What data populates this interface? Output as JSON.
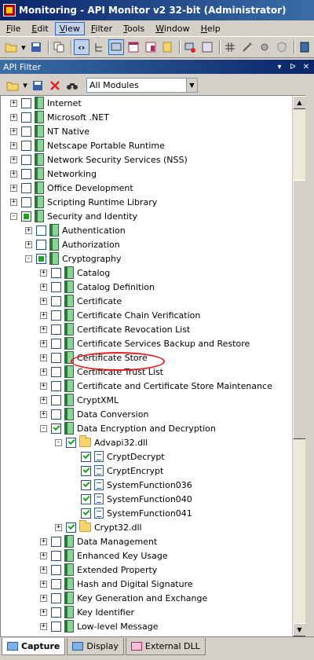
{
  "window": {
    "title": "Monitoring - API Monitor v2 32-bit (Administrator)"
  },
  "menu": [
    {
      "ul": "F",
      "rest": "ile"
    },
    {
      "ul": "E",
      "rest": "dit"
    },
    {
      "ul": "V",
      "rest": "iew",
      "active": true
    },
    {
      "ul": "F",
      "rest": "ilter"
    },
    {
      "ul": "T",
      "rest": "ools"
    },
    {
      "ul": "W",
      "rest": "indow"
    },
    {
      "ul": "H",
      "rest": "elp"
    }
  ],
  "panel": {
    "title": "API Filter",
    "buttons": [
      "▾",
      "ᐅ",
      "✕"
    ]
  },
  "filter": {
    "module_select": "All Modules"
  },
  "tree": [
    {
      "label": "Internet",
      "level": 0,
      "exp": "+",
      "chk": "",
      "icon": "book"
    },
    {
      "label": "Microsoft .NET",
      "level": 0,
      "exp": "+",
      "chk": "",
      "icon": "book"
    },
    {
      "label": "NT Native",
      "level": 0,
      "exp": "+",
      "chk": "",
      "icon": "book"
    },
    {
      "label": "Netscape Portable Runtime",
      "level": 0,
      "exp": "+",
      "chk": "",
      "icon": "book"
    },
    {
      "label": "Network Security Services (NSS)",
      "level": 0,
      "exp": "+",
      "chk": "",
      "icon": "book"
    },
    {
      "label": "Networking",
      "level": 0,
      "exp": "+",
      "chk": "",
      "icon": "book"
    },
    {
      "label": "Office Development",
      "level": 0,
      "exp": "+",
      "chk": "",
      "icon": "book"
    },
    {
      "label": "Scripting Runtime Library",
      "level": 0,
      "exp": "+",
      "chk": "",
      "icon": "book"
    },
    {
      "label": "Security and Identity",
      "level": 0,
      "exp": "−",
      "chk": "partial",
      "icon": "book"
    },
    {
      "label": "Authentication",
      "level": 1,
      "exp": "+",
      "chk": "",
      "icon": "book"
    },
    {
      "label": "Authorization",
      "level": 1,
      "exp": "+",
      "chk": "",
      "icon": "book"
    },
    {
      "label": "Cryptography",
      "level": 1,
      "exp": "−",
      "chk": "partial",
      "icon": "book"
    },
    {
      "label": "Catalog",
      "level": 2,
      "exp": "+",
      "chk": "",
      "icon": "book"
    },
    {
      "label": "Catalog Definition",
      "level": 2,
      "exp": "+",
      "chk": "",
      "icon": "book"
    },
    {
      "label": "Certificate",
      "level": 2,
      "exp": "+",
      "chk": "",
      "icon": "book"
    },
    {
      "label": "Certificate Chain Verification",
      "level": 2,
      "exp": "+",
      "chk": "",
      "icon": "book"
    },
    {
      "label": "Certificate Revocation List",
      "level": 2,
      "exp": "+",
      "chk": "",
      "icon": "book"
    },
    {
      "label": "Certificate Services Backup and Restore",
      "level": 2,
      "exp": "+",
      "chk": "",
      "icon": "book"
    },
    {
      "label": "Certificate Store",
      "level": 2,
      "exp": "+",
      "chk": "",
      "icon": "book"
    },
    {
      "label": "Certificate Trust List",
      "level": 2,
      "exp": "+",
      "chk": "",
      "icon": "book"
    },
    {
      "label": "Certificate and Certificate Store Maintenance",
      "level": 2,
      "exp": "+",
      "chk": "",
      "icon": "book"
    },
    {
      "label": "CryptXML",
      "level": 2,
      "exp": "+",
      "chk": "",
      "icon": "book"
    },
    {
      "label": "Data Conversion",
      "level": 2,
      "exp": "+",
      "chk": "",
      "icon": "book"
    },
    {
      "label": "Data Encryption and Decryption",
      "level": 2,
      "exp": "−",
      "chk": "checked",
      "icon": "book"
    },
    {
      "label": "Advapi32.dll",
      "level": 3,
      "exp": "−",
      "chk": "checked",
      "icon": "folder"
    },
    {
      "label": "CryptDecrypt",
      "level": 4,
      "exp": "",
      "chk": "checked",
      "icon": "doc"
    },
    {
      "label": "CryptEncrypt",
      "level": 4,
      "exp": "",
      "chk": "checked",
      "icon": "doc"
    },
    {
      "label": "SystemFunction036",
      "level": 4,
      "exp": "",
      "chk": "checked",
      "icon": "doc"
    },
    {
      "label": "SystemFunction040",
      "level": 4,
      "exp": "",
      "chk": "checked",
      "icon": "doc"
    },
    {
      "label": "SystemFunction041",
      "level": 4,
      "exp": "",
      "chk": "checked",
      "icon": "doc"
    },
    {
      "label": "Crypt32.dll",
      "level": 3,
      "exp": "+",
      "chk": "checked",
      "icon": "folder"
    },
    {
      "label": "Data Management",
      "level": 2,
      "exp": "+",
      "chk": "",
      "icon": "book"
    },
    {
      "label": "Enhanced Key Usage",
      "level": 2,
      "exp": "+",
      "chk": "",
      "icon": "book"
    },
    {
      "label": "Extended Property",
      "level": 2,
      "exp": "+",
      "chk": "",
      "icon": "book"
    },
    {
      "label": "Hash and Digital Signature",
      "level": 2,
      "exp": "+",
      "chk": "",
      "icon": "book"
    },
    {
      "label": "Key Generation and Exchange",
      "level": 2,
      "exp": "+",
      "chk": "",
      "icon": "book"
    },
    {
      "label": "Key Identifier",
      "level": 2,
      "exp": "+",
      "chk": "",
      "icon": "book"
    },
    {
      "label": "Low-level Message",
      "level": 2,
      "exp": "+",
      "chk": "",
      "icon": "book"
    }
  ],
  "tabs": [
    {
      "label": "Capture",
      "active": true,
      "icon": "capture-icon"
    },
    {
      "label": "Display",
      "active": false,
      "icon": "display-icon"
    },
    {
      "label": "External DLL",
      "active": false,
      "icon": "external-dll-icon"
    }
  ]
}
